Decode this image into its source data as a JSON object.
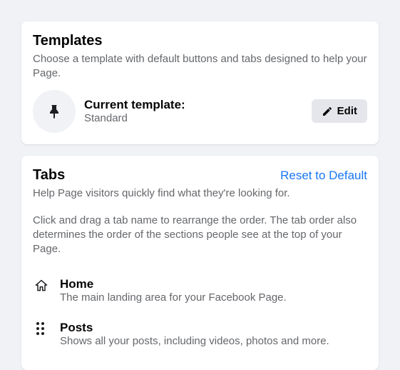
{
  "templates": {
    "title": "Templates",
    "description": "Choose a template with default buttons and tabs designed to help your Page.",
    "current_label": "Current template:",
    "current_value": "Standard",
    "edit_label": "Edit"
  },
  "tabs": {
    "title": "Tabs",
    "reset_label": "Reset to Default",
    "description": "Help Page visitors quickly find what they're looking for.",
    "instructions": "Click and drag a tab name to rearrange the order. The tab order also determines the order of the sections people see at the top of your Page.",
    "items": [
      {
        "name": "Home",
        "desc": "The main landing area for your Facebook Page."
      },
      {
        "name": "Posts",
        "desc": "Shows all your posts, including videos, photos and more."
      }
    ]
  }
}
